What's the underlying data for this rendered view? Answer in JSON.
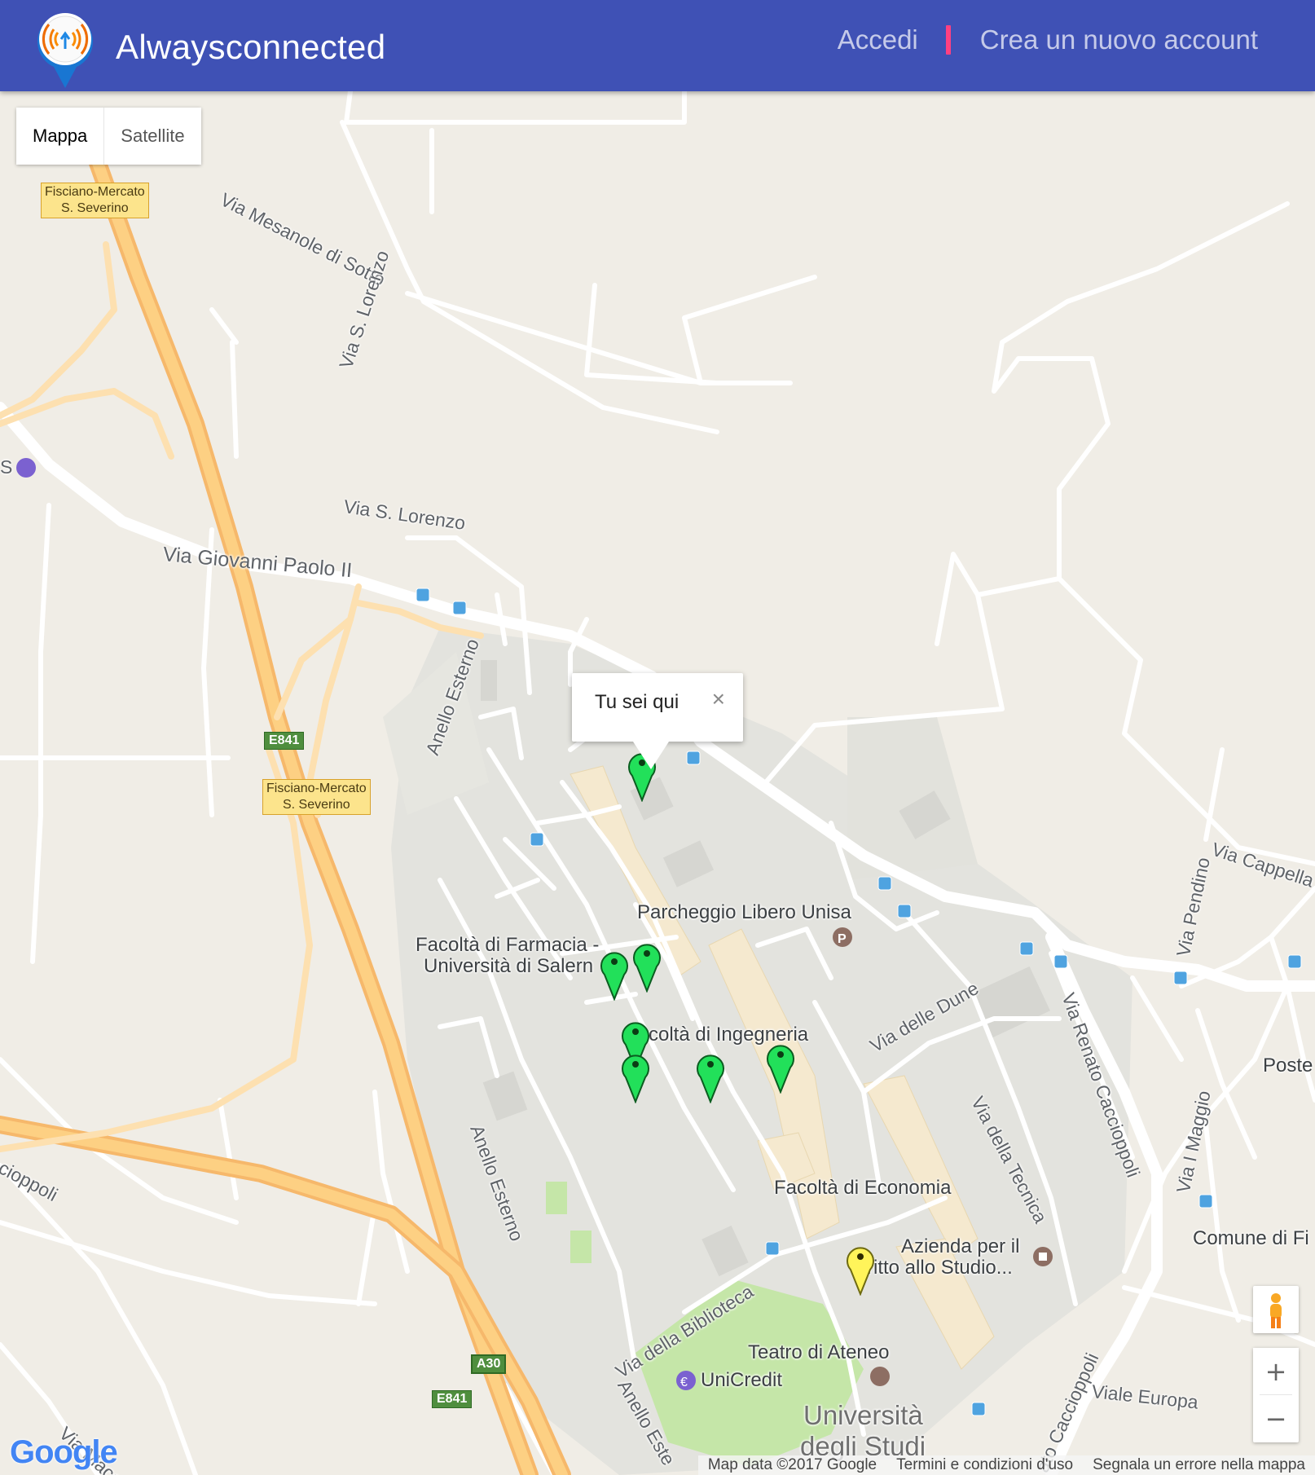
{
  "header": {
    "title": "Alwaysconnected",
    "login_label": "Accedi",
    "signup_label": "Crea un nuovo account",
    "bar_color": "#3f51b5",
    "accent_color": "#ff4081"
  },
  "map": {
    "maptype": {
      "map_label": "Mappa",
      "satellite_label": "Satellite",
      "selected": "Mappa"
    },
    "infowindow": {
      "text": "Tu sei qui",
      "close": "×"
    },
    "shields": {
      "fisciano_top": {
        "line1": "Fisciano-Mercato",
        "line2": "S. Severino"
      },
      "fisciano_mid": {
        "line1": "Fisciano-Mercato",
        "line2": "S. Severino"
      },
      "e841_top": "E841",
      "e841_bottom": "E841",
      "a30": "A30"
    },
    "roads": {
      "mesanole": "Via Mesanole di Sotto",
      "s_lorenzo_v": "Via S. Lorenzo",
      "s_lorenzo_h": "Via S. Lorenzo",
      "giovanni_paolo": "Via Giovanni Paolo II",
      "anello_1": "Anello Esterno",
      "anello_2": "Anello Esterno",
      "anello_3": "Anello Este",
      "dune": "Via delle Dune",
      "tecnica": "Via della Tecnica",
      "cacciopoli_1": "Via Renato Caccioppoli",
      "cacciopoli_2": "ato Caccioppoli",
      "pendino": "Via Pendino",
      "cappella": "Via Cappella",
      "maggio": "Via I Maggio",
      "biblioteca": "Via della Biblioteca",
      "europa": "Viale Europa",
      "cioppoli_left": "cioppoli",
      "macchia": "Via Macchi",
      "s_left": "S"
    },
    "places": {
      "parcheggio": "Parcheggio Libero Unisa",
      "farmacia_1": "Facoltà di Farmacia -",
      "farmacia_2": "Università di Salern",
      "ingegneria": "coltà di Ingegneria",
      "economia": "Facoltà di Economia",
      "azienda_1": "Azienda per il",
      "azienda_2": "ritto allo Studio...",
      "teatro": "Teatro di Ateneo",
      "unicredit": "UniCredit",
      "universita_1": "Università",
      "universita_2": "degli Studi",
      "poste": "Poste",
      "comune": "Comune di Fi"
    },
    "markers": [
      {
        "color": "green"
      },
      {
        "color": "green"
      },
      {
        "color": "green"
      },
      {
        "color": "green"
      },
      {
        "color": "green"
      },
      {
        "color": "green"
      },
      {
        "color": "green"
      },
      {
        "color": "yellow"
      }
    ],
    "controls": {
      "zoom_in": "+",
      "zoom_out": "−"
    },
    "google_logo": "Google",
    "attribution": {
      "data": "Map data ©2017 Google",
      "terms": "Termini e condizioni d'uso",
      "report": "Segnala un errore nella mappa"
    }
  }
}
